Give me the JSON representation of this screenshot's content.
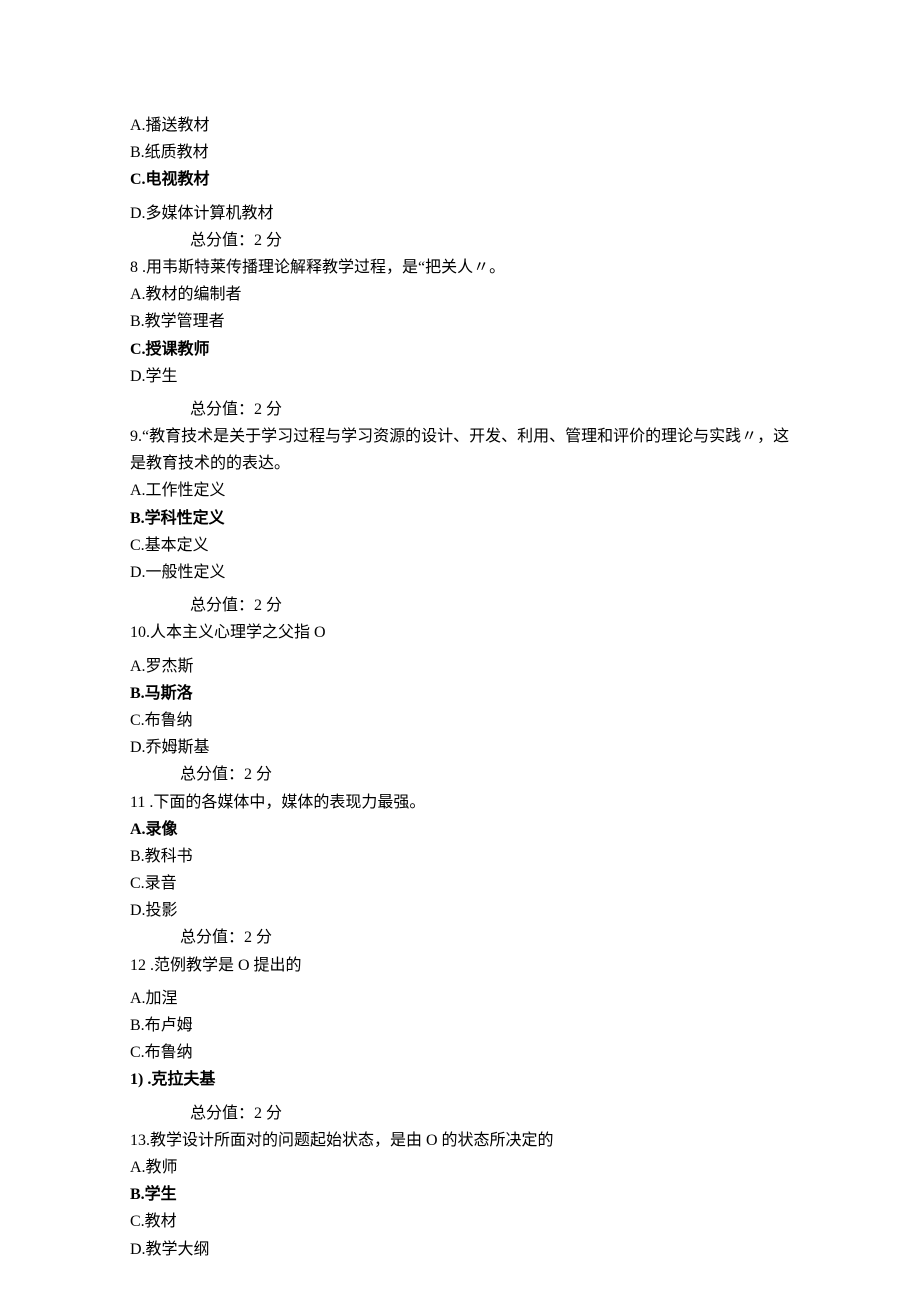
{
  "lines": [
    {
      "text": "A.播送教材",
      "bold": false,
      "class": ""
    },
    {
      "text": "B.纸质教材",
      "bold": false,
      "class": ""
    },
    {
      "text": "C.电视教材",
      "bold": true,
      "class": ""
    },
    {
      "text": "D.多媒体计算机教材",
      "bold": false,
      "class": "gap"
    },
    {
      "text": "总分值：2 分",
      "bold": false,
      "class": "indent1"
    },
    {
      "text": "8 .用韦斯特莱传播理论解释教学过程，是“把关人〃。",
      "bold": false,
      "class": ""
    },
    {
      "text": "A.教材的编制者",
      "bold": false,
      "class": ""
    },
    {
      "text": "B.教学管理者",
      "bold": false,
      "class": ""
    },
    {
      "text": "C.授课教师",
      "bold": true,
      "class": ""
    },
    {
      "text": "D.学生",
      "bold": false,
      "class": ""
    },
    {
      "text": "总分值：2 分",
      "bold": false,
      "class": "indent1 gap"
    },
    {
      "text": "9.“教育技术是关于学习过程与学习资源的设计、开发、利用、管理和评价的理论与实践〃，这是教育技术的的表达。",
      "bold": false,
      "class": ""
    },
    {
      "text": "A.工作性定义",
      "bold": false,
      "class": ""
    },
    {
      "text": "B.学科性定义",
      "bold": true,
      "class": ""
    },
    {
      "text": "C.基本定义",
      "bold": false,
      "class": ""
    },
    {
      "text": "D.一般性定义",
      "bold": false,
      "class": ""
    },
    {
      "text": "总分值：2 分",
      "bold": false,
      "class": "indent1 gap"
    },
    {
      "text": "10.人本主义心理学之父指 O",
      "bold": false,
      "class": ""
    },
    {
      "text": "A.罗杰斯",
      "bold": false,
      "class": "gap"
    },
    {
      "text": "B.马斯洛",
      "bold": true,
      "class": ""
    },
    {
      "text": "C.布鲁纳",
      "bold": false,
      "class": ""
    },
    {
      "text": "D.乔姆斯基",
      "bold": false,
      "class": ""
    },
    {
      "text": "总分值：2 分",
      "bold": false,
      "class": "indent2"
    },
    {
      "text": "11 .下面的各媒体中，媒体的表现力最强。",
      "bold": false,
      "class": ""
    },
    {
      "text": "A.录像",
      "bold": true,
      "class": ""
    },
    {
      "text": "B.教科书",
      "bold": false,
      "class": ""
    },
    {
      "text": "C.录音",
      "bold": false,
      "class": ""
    },
    {
      "text": "D.投影",
      "bold": false,
      "class": ""
    },
    {
      "text": "总分值：2 分",
      "bold": false,
      "class": "indent2"
    },
    {
      "text": "12 .范例教学是 O 提出的",
      "bold": false,
      "class": ""
    },
    {
      "text": "A.加涅",
      "bold": false,
      "class": "gap"
    },
    {
      "text": "B.布卢姆",
      "bold": false,
      "class": ""
    },
    {
      "text": "C.布鲁纳",
      "bold": false,
      "class": ""
    },
    {
      "text": "1) .克拉夫基",
      "bold": true,
      "class": ""
    },
    {
      "text": "总分值：2 分",
      "bold": false,
      "class": "indent1 gap"
    },
    {
      "text": "13.教学设计所面对的问题起始状态，是由 O 的状态所决定的",
      "bold": false,
      "class": ""
    },
    {
      "text": "A.教师",
      "bold": false,
      "class": ""
    },
    {
      "text": "B.学生",
      "bold": true,
      "class": ""
    },
    {
      "text": "C.教材",
      "bold": false,
      "class": ""
    },
    {
      "text": "D.教学大纲",
      "bold": false,
      "class": ""
    }
  ]
}
